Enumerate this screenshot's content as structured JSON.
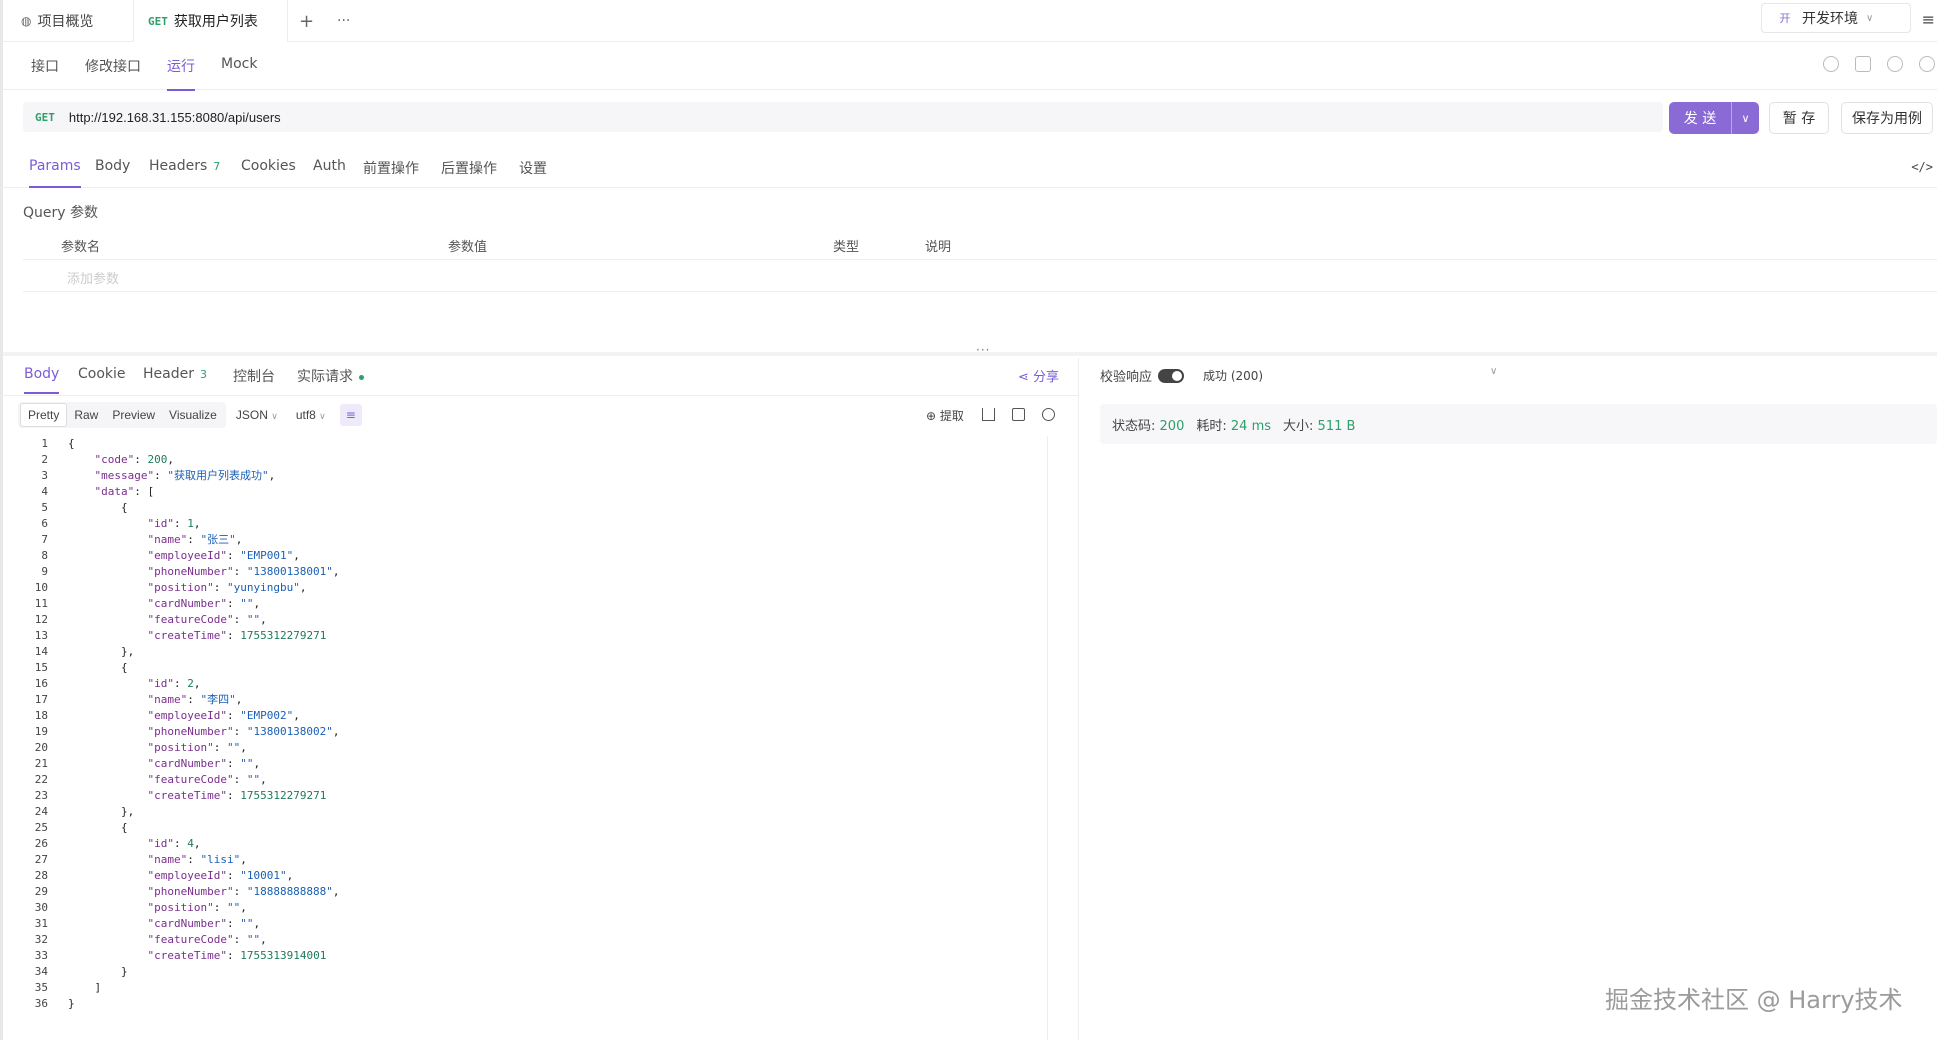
{
  "top_tabs": {
    "overview": "项目概览",
    "request_method": "GET",
    "request_name": "获取用户列表",
    "add": "+",
    "more": "···"
  },
  "env": {
    "badge": "开",
    "label": "开发环境",
    "menu": "≡"
  },
  "sub_tabs": [
    "接口",
    "修改接口",
    "运行",
    "Mock"
  ],
  "url_bar": {
    "method": "GET",
    "url": "http://192.168.31.155:8080/api/users",
    "send": "发 送",
    "save_temp": "暂 存",
    "save_case": "保存为用例"
  },
  "param_tabs": [
    {
      "label": "Params",
      "count": ""
    },
    {
      "label": "Body",
      "count": ""
    },
    {
      "label": "Headers",
      "count": "7"
    },
    {
      "label": "Cookies",
      "count": ""
    },
    {
      "label": "Auth",
      "count": ""
    },
    {
      "label": "前置操作",
      "count": ""
    },
    {
      "label": "后置操作",
      "count": ""
    },
    {
      "label": "设置",
      "count": ""
    }
  ],
  "code_toggle": "</>",
  "query": {
    "title": "Query 参数",
    "columns": [
      "参数名",
      "参数值",
      "类型",
      "说明"
    ],
    "add_placeholder": "添加参数"
  },
  "divider_handle": "···",
  "response_tabs": [
    {
      "label": "Body",
      "count": ""
    },
    {
      "label": "Cookie",
      "count": ""
    },
    {
      "label": "Header",
      "count": "3"
    },
    {
      "label": "控制台",
      "count": ""
    },
    {
      "label": "实际请求",
      "count": ""
    }
  ],
  "share": "分享",
  "view_modes": [
    "Pretty",
    "Raw",
    "Preview",
    "Visualize"
  ],
  "format": "JSON",
  "encoding": "utf8",
  "extract": "提取",
  "validate": {
    "label": "校验响应",
    "result": "成功 (200)"
  },
  "status": {
    "code_label": "状态码:",
    "code": "200",
    "time_label": "耗时:",
    "time": "24 ms",
    "size_label": "大小:",
    "size": "511 B"
  },
  "body_lines": [
    "{",
    "    \"code\": 200,",
    "    \"message\": \"获取用户列表成功\",",
    "    \"data\": [",
    "        {",
    "            \"id\": 1,",
    "            \"name\": \"张三\",",
    "            \"employeeId\": \"EMP001\",",
    "            \"phoneNumber\": \"13800138001\",",
    "            \"position\": \"yunyingbu\",",
    "            \"cardNumber\": \"\",",
    "            \"featureCode\": \"\",",
    "            \"createTime\": 1755312279271",
    "        },",
    "        {",
    "            \"id\": 2,",
    "            \"name\": \"李四\",",
    "            \"employeeId\": \"EMP002\",",
    "            \"phoneNumber\": \"13800138002\",",
    "            \"position\": \"\",",
    "            \"cardNumber\": \"\",",
    "            \"featureCode\": \"\",",
    "            \"createTime\": 1755312279271",
    "        },",
    "        {",
    "            \"id\": 4,",
    "            \"name\": \"lisi\",",
    "            \"employeeId\": \"10001\",",
    "            \"phoneNumber\": \"18888888888\",",
    "            \"position\": \"\",",
    "            \"cardNumber\": \"\",",
    "            \"featureCode\": \"\",",
    "            \"createTime\": 1755313914001",
    "        }",
    "    ]",
    "}"
  ],
  "watermark": "掘金技术社区 @ Harry技术",
  "colors": {
    "accent": "#8a6bd6",
    "success": "#2e9e6b"
  }
}
